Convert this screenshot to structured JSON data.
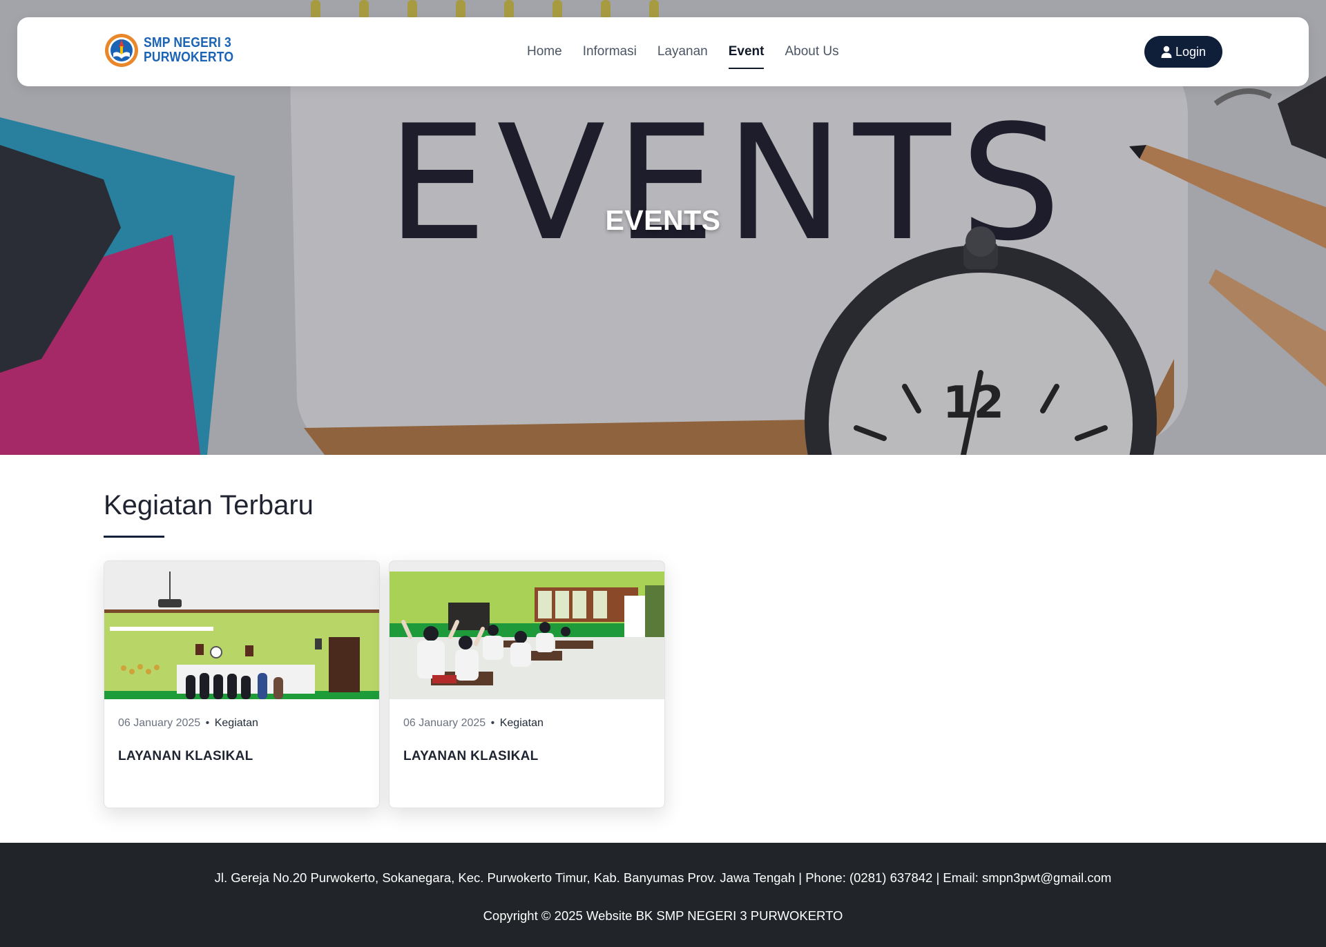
{
  "brand": {
    "line1": "SMP NEGERI 3",
    "line2": "PURWOKERTO"
  },
  "nav": {
    "items": [
      {
        "label": "Home",
        "active": false
      },
      {
        "label": "Informasi",
        "active": false
      },
      {
        "label": "Layanan",
        "active": false
      },
      {
        "label": "Event",
        "active": true
      },
      {
        "label": "About Us",
        "active": false
      }
    ],
    "login_label": "Login",
    "login_icon": "user-icon"
  },
  "hero": {
    "title": "EVENTS",
    "image_word": "EVENTS"
  },
  "section": {
    "title": "Kegiatan Terbaru"
  },
  "cards": [
    {
      "date": "06 January 2025",
      "separator": "•",
      "category": "Kegiatan",
      "title": "LAYANAN KLASIKAL"
    },
    {
      "date": "06 January 2025",
      "separator": "•",
      "category": "Kegiatan",
      "title": "LAYANAN KLASIKAL"
    }
  ],
  "footer": {
    "address": "Jl. Gereja No.20 Purwokerto, Sokanegara, Kec. Purwokerto Timur, Kab. Banyumas Prov. Jawa Tengah | Phone: (0281) 637842 | Email: smpn3pwt@gmail.com",
    "copyright": "Copyright © 2025 Website BK SMP NEGERI 3 PURWOKERTO"
  },
  "colors": {
    "navy": "#0f1f3a",
    "footer_bg": "#212529",
    "brand_blue": "#1a63b5",
    "classroom_wall": "#a9d155"
  }
}
